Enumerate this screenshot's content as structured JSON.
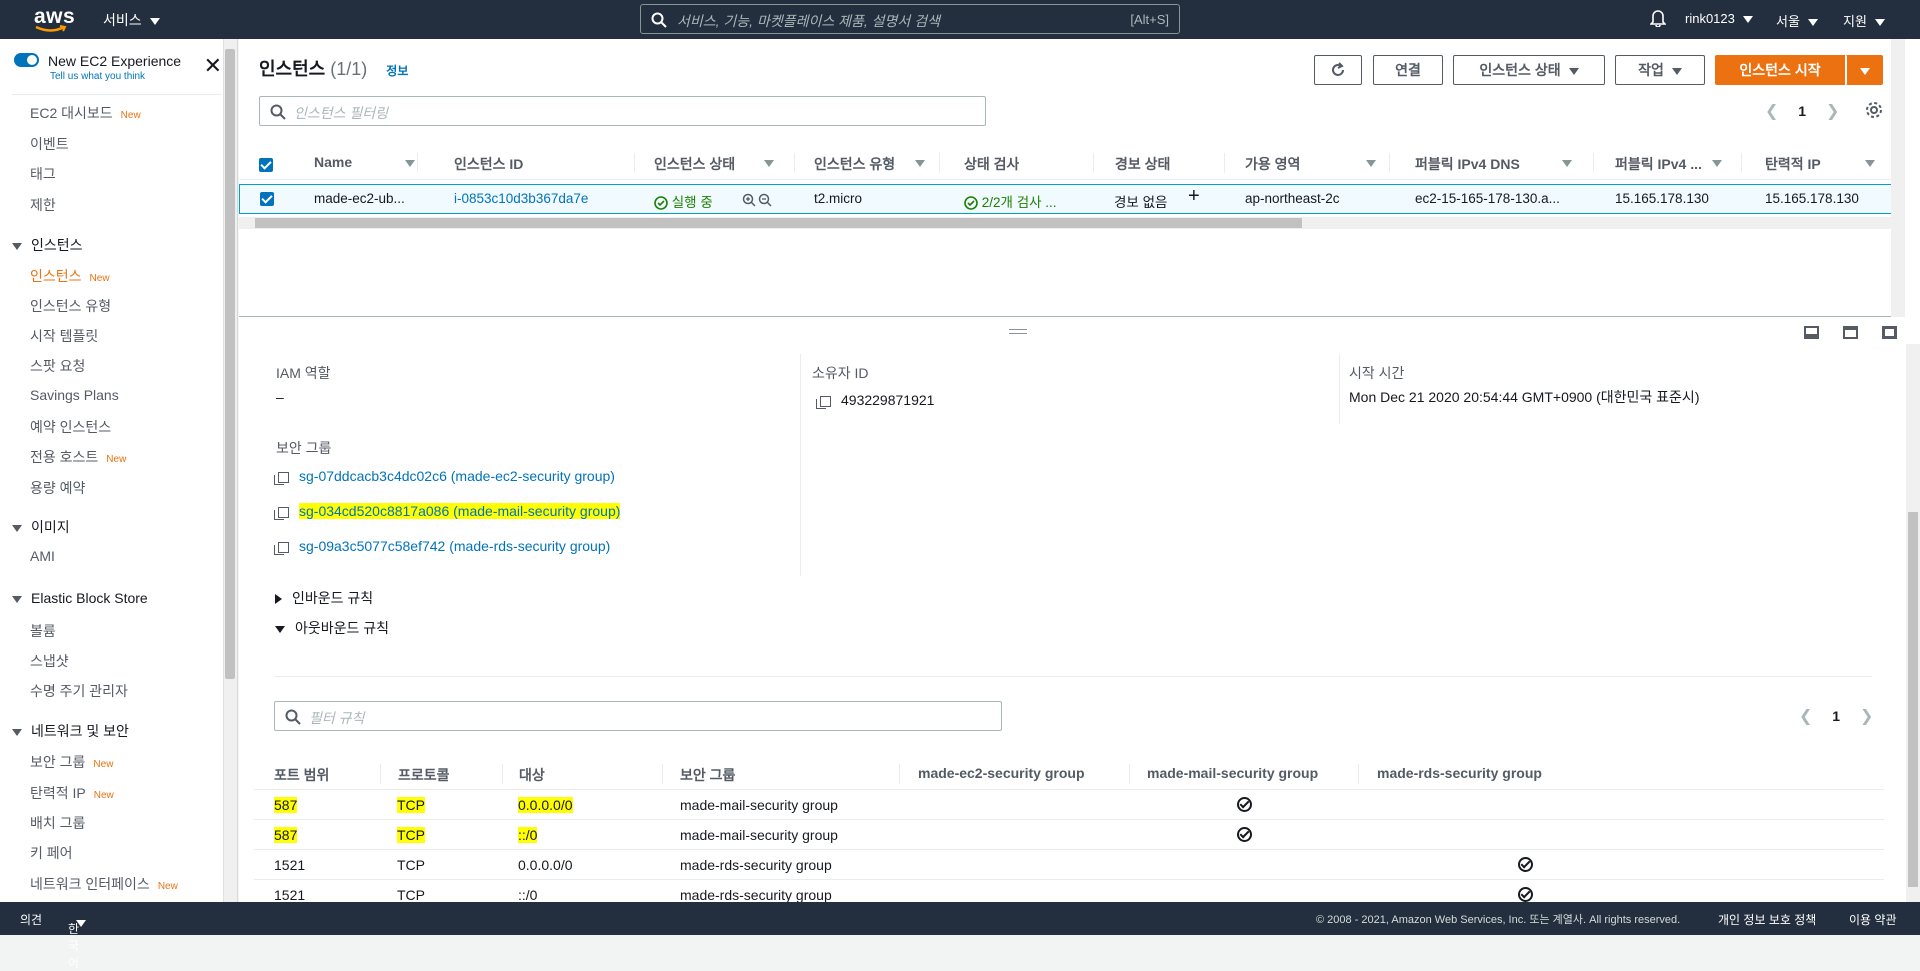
{
  "topnav": {
    "logo": "aws",
    "services": "서비스",
    "search_placeholder": "서비스, 기능, 마켓플레이스 제품, 설명서 검색",
    "search_shortcut": "[Alt+S]",
    "user": "rink0123",
    "region": "서울",
    "support": "지원"
  },
  "sidebar": {
    "new_exp_title": "New EC2 Experience",
    "new_exp_sub": "Tell us what you think",
    "new_badge": "New",
    "items": {
      "dashboard": "EC2 대시보드",
      "events": "이벤트",
      "tags": "태그",
      "limits": "제한",
      "sec_instances": "인스턴스",
      "instances": "인스턴스",
      "instance_types": "인스턴스 유형",
      "launch_templates": "시작 템플릿",
      "spot": "스팟 요청",
      "savings": "Savings Plans",
      "reserved": "예약 인스턴스",
      "dedicated": "전용 호스트",
      "capacity": "용량 예약",
      "sec_images": "이미지",
      "ami": "AMI",
      "sec_ebs": "Elastic Block Store",
      "volumes": "볼륨",
      "snapshots": "스냅샷",
      "lifecycle": "수명 주기 관리자",
      "sec_network": "네트워크 및 보안",
      "security_groups": "보안 그룹",
      "elastic_ip": "탄력적 IP",
      "placement": "배치 그룹",
      "key_pairs": "키 페어",
      "network_interfaces": "네트워크 인터페이스"
    }
  },
  "instances_panel": {
    "title": "인스턴스",
    "count": "(1/1)",
    "info": "정보",
    "btn_connect": "연결",
    "btn_state": "인스턴스 상태",
    "btn_actions": "작업",
    "btn_launch": "인스턴스 시작",
    "filter_placeholder": "인스턴스 필터링",
    "page": "1",
    "columns": [
      "Name",
      "인스턴스 ID",
      "인스턴스 상태",
      "인스턴스 유형",
      "상태 검사",
      "경보 상태",
      "가용 영역",
      "퍼블릭 IPv4 DNS",
      "퍼블릭 IPv4 ...",
      "탄력적 IP"
    ],
    "row": {
      "name": "made-ec2-ub...",
      "id": "i-0853c10d3b367da7e",
      "state": "실행 중",
      "type": "t2.micro",
      "check": "2/2개 검사 ...",
      "alarm": "경보 없음",
      "az": "ap-northeast-2c",
      "dns": "ec2-15-165-178-130.a...",
      "ipv4": "15.165.178.130",
      "eip": "15.165.178.130"
    }
  },
  "details": {
    "iam_label": "IAM 역할",
    "iam_value": "–",
    "owner_label": "소유자 ID",
    "owner_value": "493229871921",
    "launch_label": "시작 시간",
    "launch_value": "Mon Dec 21 2020 20:54:44 GMT+0900 (대한민국 표준시)",
    "sg_label": "보안 그룹",
    "security_groups": [
      "sg-07ddcacb3c4dc02c6 (made-ec2-security group)",
      "sg-034cd520c8817a086 (made-mail-security group)",
      "sg-09a3c5077c58ef742 (made-rds-security group)"
    ],
    "inbound": "인바운드 규칙",
    "outbound": "아웃바운드 규칙",
    "rules_filter_placeholder": "필터 규칙",
    "rules_page": "1",
    "rules_columns": [
      "포트 범위",
      "프로토콜",
      "대상",
      "보안 그룹",
      "made-ec2-security group",
      "made-mail-security group",
      "made-rds-security group"
    ],
    "rules": [
      {
        "port": "587",
        "proto": "TCP",
        "dest": "0.0.0.0/0",
        "sg": "made-mail-security group",
        "highlight": true,
        "ec2": false,
        "mail": true,
        "rds": false
      },
      {
        "port": "587",
        "proto": "TCP",
        "dest": "::/0",
        "sg": "made-mail-security group",
        "highlight": true,
        "ec2": false,
        "mail": true,
        "rds": false
      },
      {
        "port": "1521",
        "proto": "TCP",
        "dest": "0.0.0.0/0",
        "sg": "made-rds-security group",
        "highlight": false,
        "ec2": false,
        "mail": false,
        "rds": true
      },
      {
        "port": "1521",
        "proto": "TCP",
        "dest": "::/0",
        "sg": "made-rds-security group",
        "highlight": false,
        "ec2": false,
        "mail": false,
        "rds": true
      }
    ]
  },
  "footer": {
    "feedback": "의견",
    "language": "한국어",
    "copyright": "© 2008 - 2021, Amazon Web Services, Inc. 또는 계열사. All rights reserved.",
    "privacy": "개인 정보 보호 정책",
    "terms": "이용 약관"
  },
  "colors": {
    "accent": "#ec7211",
    "link": "#0073bb",
    "nav_bg": "#232f3e",
    "highlight": "#ffff00",
    "success": "#1d8102"
  }
}
